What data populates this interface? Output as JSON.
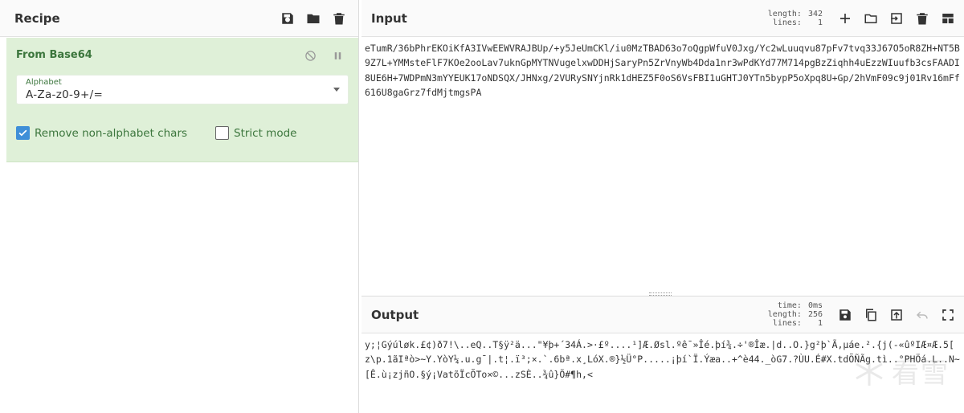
{
  "recipe": {
    "title": "Recipe",
    "operation": {
      "name": "From Base64",
      "alphabet_label": "Alphabet",
      "alphabet_value": "A-Za-z0-9+/=",
      "remove_non_alphabet": {
        "label": "Remove non-alphabet chars",
        "checked": true
      },
      "strict_mode": {
        "label": "Strict mode",
        "checked": false
      }
    }
  },
  "input": {
    "title": "Input",
    "stats": {
      "length_label": "length:",
      "length": "342",
      "lines_label": "lines:",
      "lines": "1"
    },
    "text": "eTumR/36bPhrEKOiKfA3IVwEEWVRAJBUp/+y5JeUmCKl/iu0MzTBAD63o7oQgpWfuV0Jxg/Yc2wLuuqvu87pFv7tvq33J67O5oR8ZH+NT5B9Z7L+YMMsteFlF7KOe2ooLav7uknGpMYTNVugelxwDDHjSaryPn5ZrVnyWb4Dda1nr3wPdKYd77M714pgBzZiqhh4uEzzWIuufb3csFAADI8UE6H+7WDPmN3mYYEUK17oNDSQX/JHNxg/2VURySNYjnRk1dHEZ5F0oS6VsFBI1uGHTJ0YTn5bypP5oXpq8U+Gp/2hVmF09c9j01Rv16mFf616U8gaGrz7fdMjtmgsPA"
  },
  "output": {
    "title": "Output",
    "stats": {
      "time_label": "time:",
      "time": "0ms",
      "length_label": "length:",
      "length": "256",
      "lines_label": "lines:",
      "lines": "1"
    },
    "text": "y;¦Gýúløk.£¢)ð7!\\..eQ..T§ÿ²ä...\"¥þ+´34Á.>·£º....¹]Æ.Øsl.ºê¯»Îé.þí¾.÷'®Îæ.|d..O.}g²þ`Ã,µáe.².{j(-«ûºIÆ¤Æ.5[ z\\p.1ãIªò>~Y.YòY¼.u.g¯|.t¦.ï³;×.`.6bª.x¸LóX.®}½Ü°P.....¡þí`Ï.Ýæa..+^è44._òG7.?ÙU.É#X.tdÕÑÃg.tì..°PHÖá.L..N~[Ê.ù¡zjñO.§ý¡VatõÏcÕTo×©...zSÈ..¾û}Ö#¶h,<"
  },
  "watermark": {
    "text": "看雪"
  }
}
